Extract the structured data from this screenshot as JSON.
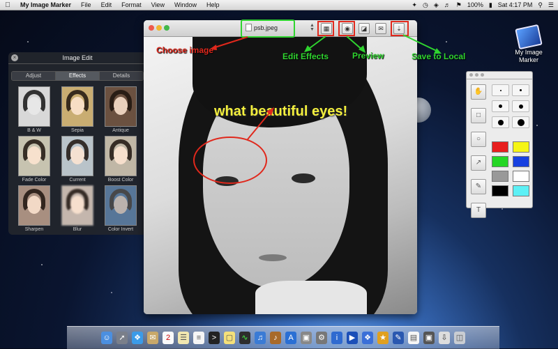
{
  "menubar": {
    "app_name": "My Image Marker",
    "menus": [
      "File",
      "Edit",
      "Format",
      "View",
      "Window",
      "Help"
    ],
    "battery": "100%",
    "clock": "Sat 4:17 PM"
  },
  "desktop_icon": {
    "label_line1": "My Image",
    "label_line2": "Marker"
  },
  "image_edit": {
    "title": "Image Edit",
    "tabs": [
      "Adjust",
      "Effects",
      "Details"
    ],
    "active_tab": "Effects",
    "effects": [
      "B & W",
      "Sepia",
      "Antique",
      "Fade Color",
      "Current",
      "Boost Color",
      "Sharpen",
      "Blur",
      "Color Invert"
    ]
  },
  "window": {
    "file_name": "psb.jpeg",
    "caption": "what beautiful eyes!"
  },
  "annotations": {
    "choose_image": "Choose image",
    "edit_effects": "Edit Effects",
    "preview": "Preview",
    "save_to_local": "Save to Local"
  },
  "colors": {
    "accent_red": "#e0281c",
    "accent_green": "#2fd42f",
    "caption_yellow": "#f3ef3d",
    "palette": [
      "#e81e1e",
      "#f5f515",
      "#25d625",
      "#1740e0",
      "#999999",
      "#ffffff",
      "#000000",
      "#5cf0f5"
    ]
  },
  "dock_icons": [
    "finder-icon",
    "launchpad-icon",
    "safari-icon",
    "mail-icon",
    "calendar-icon",
    "notes-icon",
    "reminders-icon",
    "terminal-icon",
    "stickies-icon",
    "activity-monitor-icon",
    "itunes-icon",
    "guitar-icon",
    "appstore-icon",
    "preview-icon",
    "system-prefs-icon",
    "info-icon",
    "quicktime-icon",
    "xcode-icon",
    "image-marker-icon",
    "textedit-icon",
    "photo-icon",
    "downloads-icon",
    "trash-icon"
  ]
}
